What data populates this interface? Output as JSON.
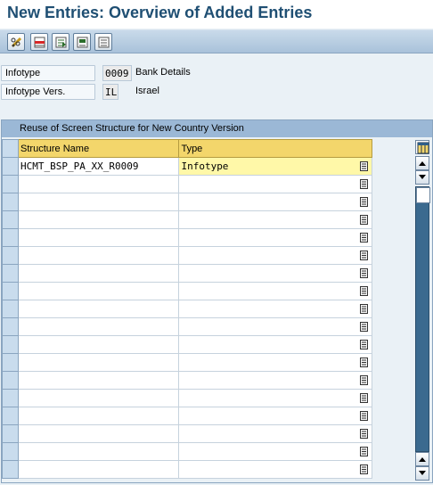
{
  "header": {
    "title": "New Entries: Overview of Added Entries"
  },
  "toolbar": {
    "buttons": [
      {
        "icon": "pencil-glasses-icon",
        "tooltip": ""
      },
      {
        "icon": "delete-row-icon",
        "tooltip": ""
      },
      {
        "icon": "select-all-icon",
        "tooltip": ""
      },
      {
        "icon": "select-block-icon",
        "tooltip": ""
      },
      {
        "icon": "deselect-all-icon",
        "tooltip": ""
      }
    ]
  },
  "fields": {
    "infotype": {
      "label": "Infotype",
      "value": "0009",
      "description": "Bank Details"
    },
    "infotype_version": {
      "label": "Infotype Vers.",
      "value": "IL",
      "description": "Israel"
    }
  },
  "table": {
    "title": "Reuse of Screen Structure for New Country Version",
    "columns": [
      "Structure Name",
      "Type"
    ],
    "rows": [
      {
        "structure": "HCMT_BSP_PA_XX_R0009",
        "type": "Infotype"
      },
      {
        "structure": "",
        "type": ""
      },
      {
        "structure": "",
        "type": ""
      },
      {
        "structure": "",
        "type": ""
      },
      {
        "structure": "",
        "type": ""
      },
      {
        "structure": "",
        "type": ""
      },
      {
        "structure": "",
        "type": ""
      },
      {
        "structure": "",
        "type": ""
      },
      {
        "structure": "",
        "type": ""
      },
      {
        "structure": "",
        "type": ""
      },
      {
        "structure": "",
        "type": ""
      },
      {
        "structure": "",
        "type": ""
      },
      {
        "structure": "",
        "type": ""
      },
      {
        "structure": "",
        "type": ""
      },
      {
        "structure": "",
        "type": ""
      },
      {
        "structure": "",
        "type": ""
      },
      {
        "structure": "",
        "type": ""
      },
      {
        "structure": "",
        "type": ""
      }
    ]
  },
  "colors": {
    "title": "#1f4f73",
    "header_yellow": "#f3d66b",
    "active_cell": "#fff8a8",
    "scroll_track": "#3b6a8f"
  }
}
